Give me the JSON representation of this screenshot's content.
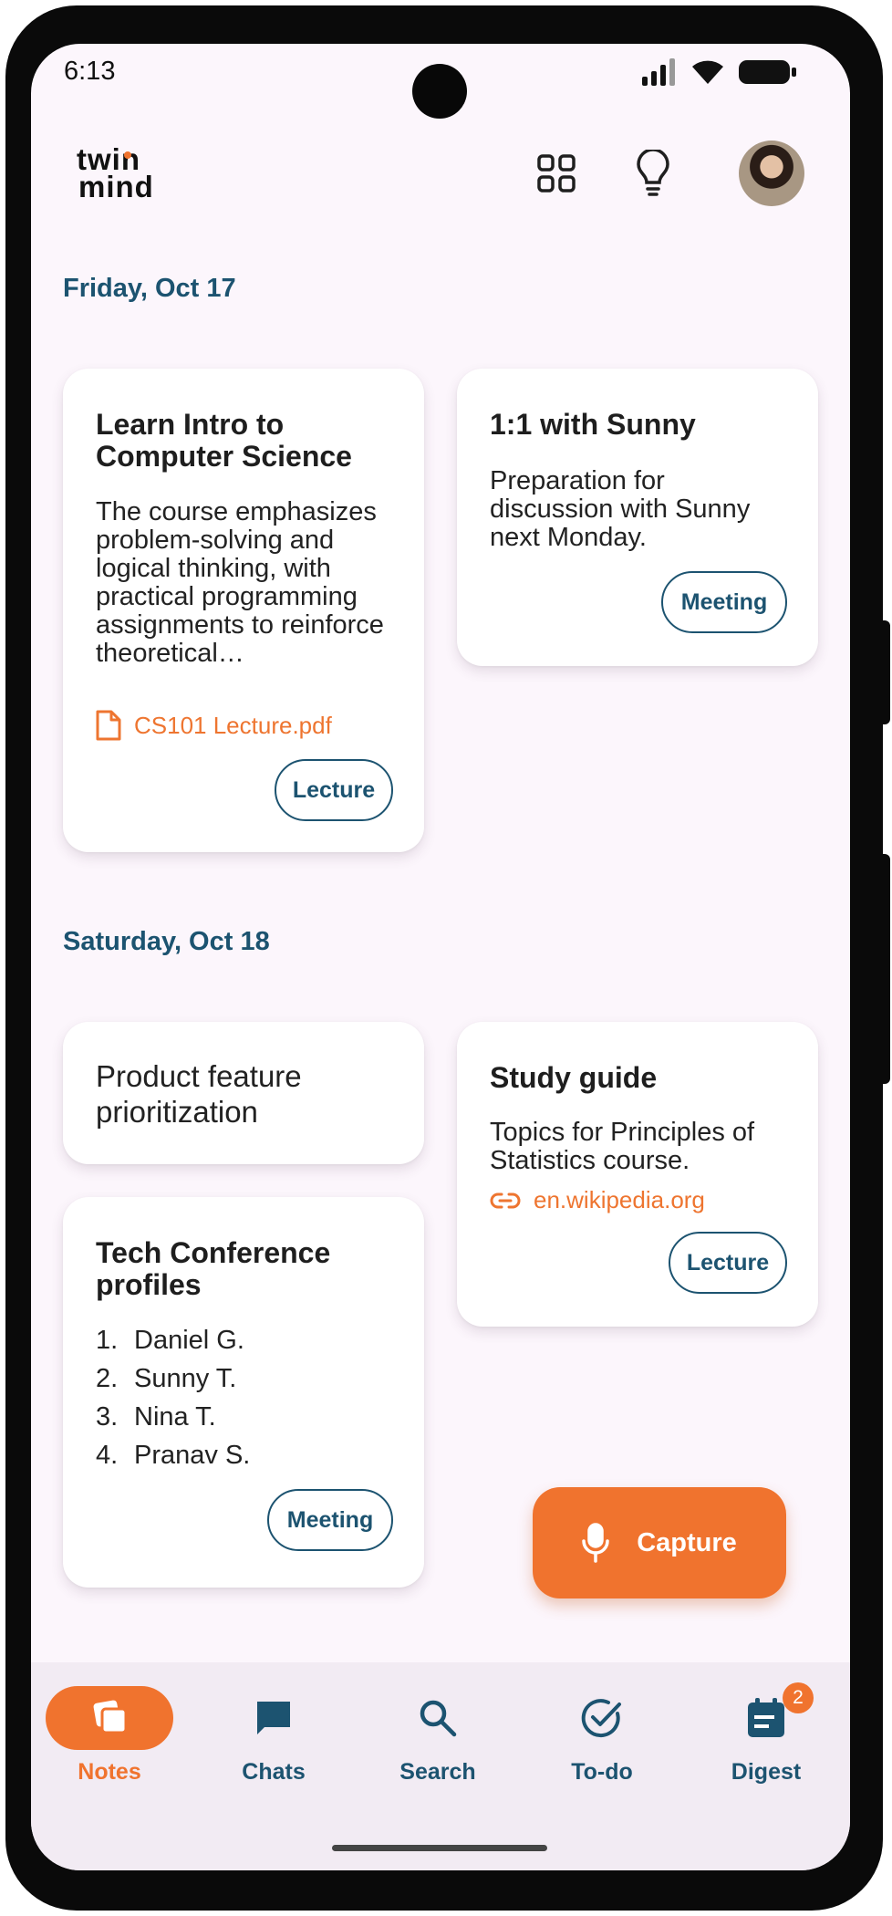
{
  "status_bar": {
    "time": "6:13"
  },
  "header": {
    "logo_line1": "twin",
    "logo_line2": "mind"
  },
  "colors": {
    "accent": "#F0732E",
    "primary": "#1C5370",
    "background": "#FCF6FC",
    "card": "#FFFFFF"
  },
  "sections": [
    {
      "date": "Friday, Oct 17",
      "cards": [
        {
          "title": "Learn Intro to Computer Science",
          "body": "The course emphasizes problem-solving and logical thinking, with practical programming assignments to reinforce theoretical…",
          "attachment": "CS101 Lecture.pdf",
          "attachment_icon": "file-icon",
          "tag": "Lecture"
        },
        {
          "title": "1:1 with Sunny",
          "body": "Preparation for discussion with Sunny next Monday.",
          "tag": "Meeting"
        }
      ]
    },
    {
      "date": "Saturday, Oct 18",
      "cards": [
        {
          "title": "Product feature prioritization"
        },
        {
          "title": "Study guide",
          "body": "Topics for Principles of Statistics course.",
          "attachment": "en.wikipedia.org",
          "attachment_icon": "link-icon",
          "tag": "Lecture"
        },
        {
          "title": "Tech Conference profiles",
          "list": [
            "Daniel G.",
            "Sunny T.",
            "Nina T.",
            "Pranav S."
          ],
          "tag": "Meeting"
        }
      ]
    }
  ],
  "fab": {
    "label": "Capture",
    "icon": "microphone-icon"
  },
  "bottom_nav": [
    {
      "label": "Notes",
      "icon": "notes-icon",
      "active": true
    },
    {
      "label": "Chats",
      "icon": "chat-icon"
    },
    {
      "label": "Search",
      "icon": "search-icon"
    },
    {
      "label": "To-do",
      "icon": "todo-check-icon"
    },
    {
      "label": "Digest",
      "icon": "digest-icon",
      "badge": "2"
    }
  ]
}
